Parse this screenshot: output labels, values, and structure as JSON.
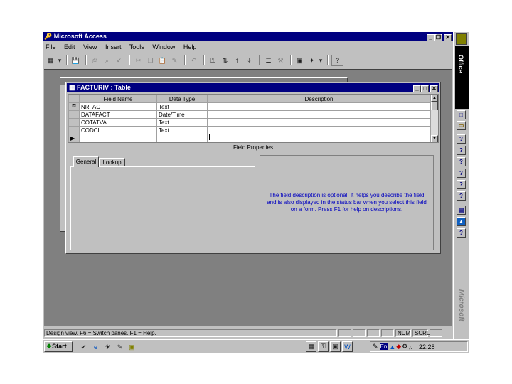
{
  "app": {
    "title": "Microsoft Access",
    "menu": [
      "File",
      "Edit",
      "View",
      "Insert",
      "Tools",
      "Window",
      "Help"
    ]
  },
  "table_window": {
    "title": "FACTURIV : Table",
    "columns": [
      "Field Name",
      "Data Type",
      "Description"
    ],
    "rows": [
      {
        "field": "NRFACT",
        "type": "Text",
        "desc": "",
        "key": true
      },
      {
        "field": "DATAFACT",
        "type": "Date/Time",
        "desc": "",
        "key": false
      },
      {
        "field": "COTATVA",
        "type": "Text",
        "desc": "",
        "key": false
      },
      {
        "field": "CODCL",
        "type": "Text",
        "desc": "",
        "key": false
      },
      {
        "field": "",
        "type": "",
        "desc": "",
        "key": false
      }
    ],
    "field_properties_label": "Field Properties",
    "tabs": [
      "General",
      "Lookup"
    ],
    "help_text": "The field description is optional.  It helps you describe the field and is also displayed in the status bar when you select this field on a form.  Press F1 for help on descriptions."
  },
  "office_bar": {
    "label": "Office",
    "brand": "Microsoft"
  },
  "status": {
    "text": "Design view.  F6 = Switch panes.  F1 = Help.",
    "num": "NUM",
    "scrl": "SCRL"
  },
  "taskbar": {
    "start": "Start",
    "clock": "22:28",
    "lang": "En"
  },
  "colors": {
    "title_bar": "#000080",
    "desktop": "#808080",
    "face": "#c0c0c0",
    "help_text": "#0000c0"
  }
}
